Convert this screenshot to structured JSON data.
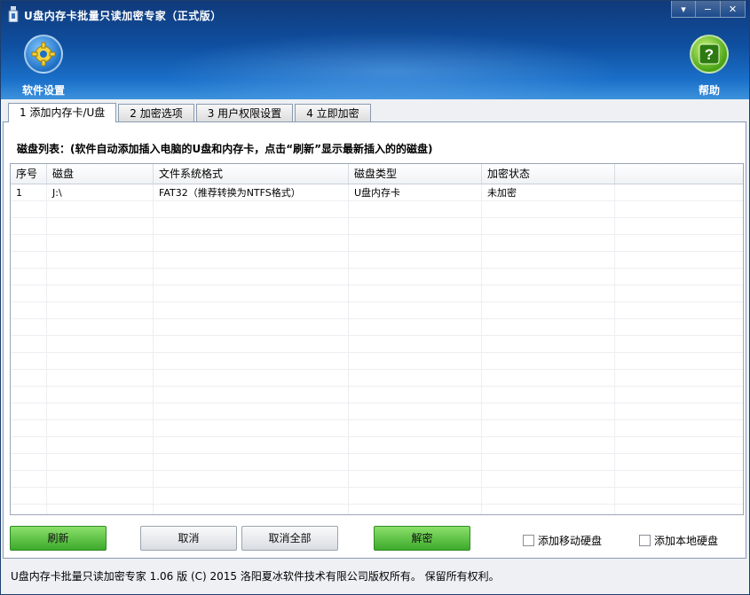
{
  "window": {
    "title": "U盘内存卡批量只读加密专家（正式版）",
    "min_symbol": "−",
    "close_symbol": "✕",
    "menu_symbol": "▾"
  },
  "toolbar": {
    "settings_label": "软件设置",
    "help_label": "帮助"
  },
  "tabs": [
    {
      "label": "1 添加内存卡/U盘",
      "active": true
    },
    {
      "label": "2 加密选项",
      "active": false
    },
    {
      "label": "3 用户权限设置",
      "active": false
    },
    {
      "label": "4 立即加密",
      "active": false
    }
  ],
  "disk_list": {
    "label": "磁盘列表：(软件自动添加插入电脑的U盘和内存卡，点击“刷新”显示最新插入的的磁盘)",
    "columns": [
      "序号",
      "磁盘",
      "文件系统格式",
      "磁盘类型",
      "加密状态",
      ""
    ],
    "rows": [
      [
        "1",
        "J:\\",
        "FAT32（推荐转换为NTFS格式）",
        "U盘内存卡",
        "未加密",
        ""
      ]
    ]
  },
  "buttons": {
    "refresh": "刷新",
    "cancel": "取消",
    "cancel_all": "取消全部",
    "decrypt": "解密"
  },
  "checkboxes": {
    "add_removable": "添加移动硬盘",
    "add_local": "添加本地硬盘"
  },
  "status_bar": {
    "text": "U盘内存卡批量只读加密专家 1.06 版  (C)  2015 洛阳夏冰软件技术有限公司版权所有。 保留所有权利。"
  },
  "colors": {
    "header_top": "#103a7a",
    "header_bottom": "#3d92dd",
    "button_green": "#3caa2c"
  }
}
